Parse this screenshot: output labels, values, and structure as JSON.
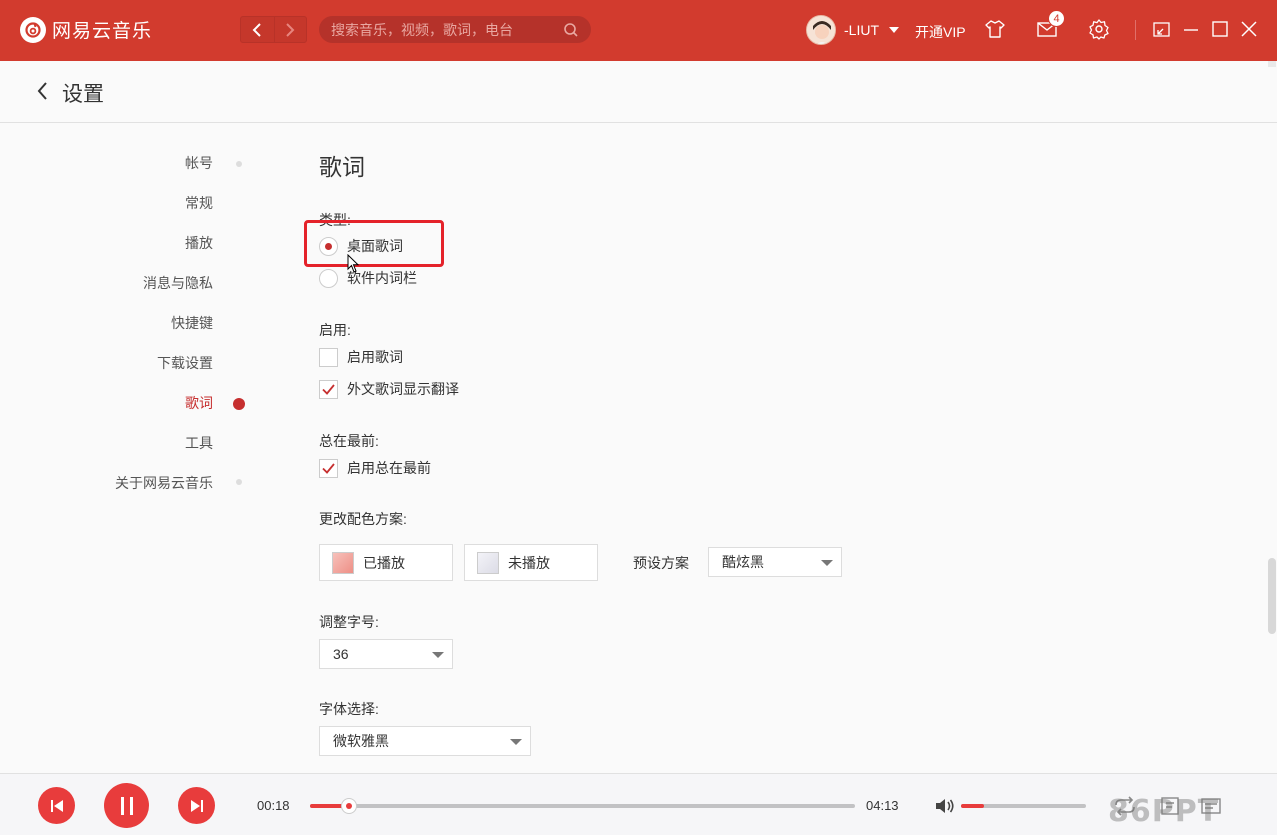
{
  "app": {
    "name": "网易云音乐"
  },
  "topbar": {
    "search_placeholder": "搜索音乐，视频，歌词，电台",
    "username": "-LIUT",
    "vip_label": "开通VIP",
    "mail_count": "4"
  },
  "page": {
    "title": "设置"
  },
  "sidebar": {
    "items": [
      {
        "label": "帐号"
      },
      {
        "label": "常规"
      },
      {
        "label": "播放"
      },
      {
        "label": "消息与隐私"
      },
      {
        "label": "快捷键"
      },
      {
        "label": "下载设置"
      },
      {
        "label": "歌词"
      },
      {
        "label": "工具"
      },
      {
        "label": "关于网易云音乐"
      }
    ],
    "active": "歌词"
  },
  "lyrics": {
    "title": "歌词",
    "type_label": "类型:",
    "type_options": [
      {
        "label": "桌面歌词",
        "checked": true
      },
      {
        "label": "软件内词栏",
        "checked": false
      }
    ],
    "enable_label": "启用:",
    "enable_options": [
      {
        "label": "启用歌词",
        "checked": false
      },
      {
        "label": "外文歌词显示翻译",
        "checked": true
      }
    ],
    "ontop_label": "总在最前:",
    "ontop_options": [
      {
        "label": "启用总在最前",
        "checked": true
      }
    ],
    "color_label": "更改配色方案:",
    "played_label": "已播放",
    "played_color": "#f2a49d",
    "unplayed_label": "未播放",
    "unplayed_color": "#e6e6ee",
    "preset_label": "预设方案",
    "preset_value": "酷炫黑",
    "fontsize_label": "调整字号:",
    "fontsize_value": "36",
    "font_label": "字体选择:",
    "font_value": "微软雅黑"
  },
  "player": {
    "current_time": "00:18",
    "total_time": "04:13",
    "progress": 0.072,
    "volume": 0.18
  },
  "watermark": "86PPT",
  "colors": {
    "accent": "#d23b2e",
    "active": "#c62f2f",
    "player_red": "#e83c3c"
  }
}
